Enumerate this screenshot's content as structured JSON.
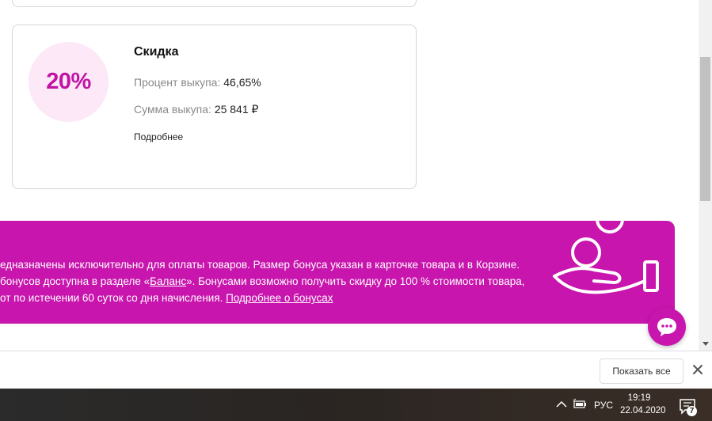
{
  "discount": {
    "value": "20%",
    "title": "Скидка",
    "buyout_percent_label": "Процент выкупа:",
    "buyout_percent_value": "46,65%",
    "buyout_sum_label": "Сумма выкупа:",
    "buyout_sum_value": "25 841 ₽",
    "more_link": "Подробнее"
  },
  "banner": {
    "line1": "едназначены исключительно для оплаты товаров. Размер бонуса указан в карточке товара и в Корзине.",
    "line2_pre": "бонусов доступна в разделе «",
    "line2_link": "Баланс",
    "line2_post": "». Бонусами возможно получить скидку до 100 % стоимости товара,",
    "line3_pre": "от по истечении 60 суток со дня начисления. ",
    "line3_link": "Подробнее о бонусах",
    "accent_color": "#c815ad"
  },
  "download_bar": {
    "show_all": "Показать все"
  },
  "taskbar": {
    "language": "РУС",
    "time": "19:19",
    "date": "22.04.2020",
    "notification_count": "7"
  }
}
